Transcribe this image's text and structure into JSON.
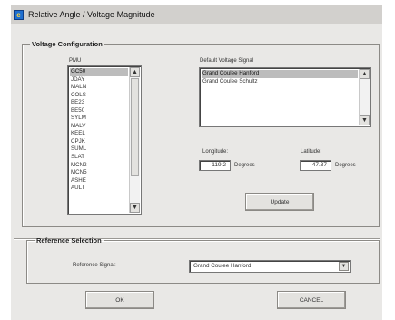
{
  "window": {
    "title": "Relative Angle / Voltage Magnitude",
    "icon": "matlab-figure-icon"
  },
  "voltage_configuration": {
    "legend": "Voltage Configuration",
    "pmu_label": "PMU",
    "pmu_items": [
      "GC50",
      "JDAY",
      "MALN",
      "COLS",
      "BE23",
      "BE50",
      "SYLM",
      "MALV",
      "KEEL",
      "CPJK",
      "SUML",
      "SLAT",
      "MCN2",
      "MCN5",
      "ASHE",
      "AULT"
    ],
    "pmu_selected": "GC50",
    "signal_label": "Default Voltage Signal",
    "signal_items": [
      "Grand Coulee Hanford",
      "Grand Coulee Schultz"
    ],
    "signal_selected": "Grand Coulee Hanford",
    "longitude_label": "Longitude:",
    "longitude_value": "-119.2",
    "longitude_unit": "Degrees",
    "latitude_label": "Latitude:",
    "latitude_value": "47.37",
    "latitude_unit": "Degrees",
    "update_label": "Update"
  },
  "reference_selection": {
    "legend": "Reference Selection",
    "signal_label": "Reference Signal:",
    "signal_value": "Grand Coulee Hanford"
  },
  "actions": {
    "ok_label": "OK",
    "cancel_label": "CANCEL"
  }
}
